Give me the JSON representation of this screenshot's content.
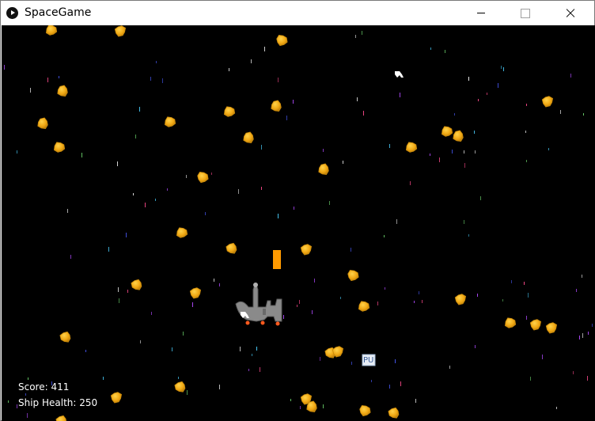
{
  "window": {
    "title": "SpaceGame",
    "icon": "play-circle-icon"
  },
  "hud": {
    "score_label": "Score:",
    "score": "411",
    "health_label": "Ship Health:",
    "health": "250"
  },
  "powerup": {
    "label": "PU"
  },
  "colors": {
    "background": "#000000",
    "asteroid": "#f5b418",
    "asteroid_dark": "#c98a0a",
    "bullet": "#ff9a00",
    "ship": "#8c8c8c",
    "hud_text": "#ffffff"
  }
}
